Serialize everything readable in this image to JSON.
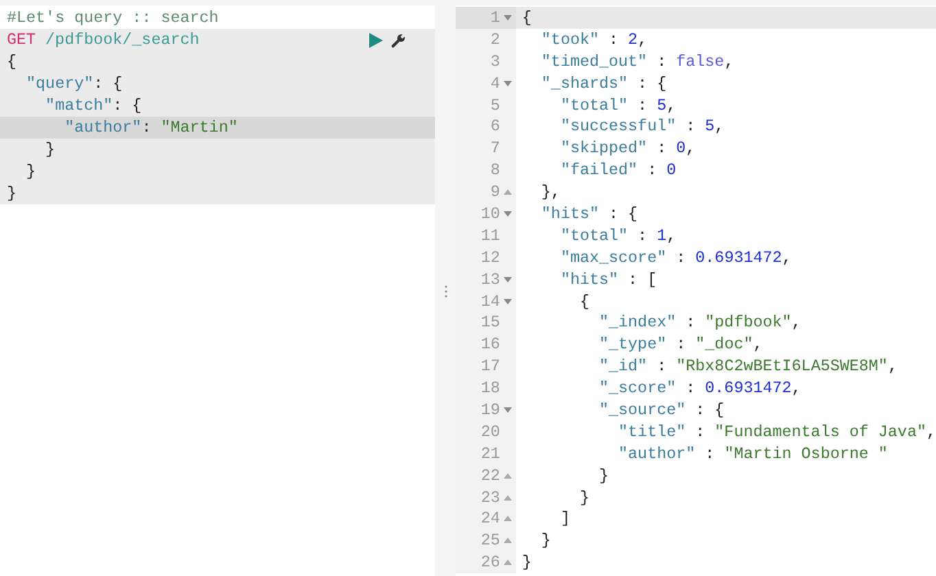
{
  "request_editor": {
    "comment": "#Let's query :: search",
    "method": "GET",
    "url": "/pdfbook/_search",
    "lines": [
      {
        "active": false,
        "tokens": [
          {
            "text": "{",
            "kind": "punct"
          }
        ]
      },
      {
        "active": false,
        "tokens": [
          {
            "text": "  \"query\"",
            "kind": "key"
          },
          {
            "text": ": {",
            "kind": "punct"
          }
        ]
      },
      {
        "active": false,
        "tokens": [
          {
            "text": "    \"match\"",
            "kind": "key"
          },
          {
            "text": ": {",
            "kind": "punct"
          }
        ]
      },
      {
        "active": true,
        "tokens": [
          {
            "text": "      \"author\"",
            "kind": "key"
          },
          {
            "text": ": ",
            "kind": "punct"
          },
          {
            "text": "\"Martin\"",
            "kind": "string"
          }
        ]
      },
      {
        "active": false,
        "tokens": [
          {
            "text": "    }",
            "kind": "punct"
          }
        ]
      },
      {
        "active": false,
        "tokens": [
          {
            "text": "  }",
            "kind": "punct"
          }
        ]
      },
      {
        "active": false,
        "tokens": [
          {
            "text": "}",
            "kind": "punct"
          }
        ]
      }
    ]
  },
  "response_viewer": {
    "lines": [
      {
        "number": "1",
        "kind": "open",
        "active": true,
        "tokens": [
          {
            "text": "{",
            "kind": "punct"
          }
        ]
      },
      {
        "number": "2",
        "kind": "plain",
        "active": false,
        "tokens": [
          {
            "text": "  \"took\"",
            "kind": "key"
          },
          {
            "text": " : ",
            "kind": "punct"
          },
          {
            "text": "2",
            "kind": "number"
          },
          {
            "text": ",",
            "kind": "punct"
          }
        ]
      },
      {
        "number": "3",
        "kind": "plain",
        "active": false,
        "tokens": [
          {
            "text": "  \"timed_out\"",
            "kind": "key"
          },
          {
            "text": " : ",
            "kind": "punct"
          },
          {
            "text": "false",
            "kind": "boolean"
          },
          {
            "text": ",",
            "kind": "punct"
          }
        ]
      },
      {
        "number": "4",
        "kind": "open",
        "active": false,
        "tokens": [
          {
            "text": "  \"_shards\"",
            "kind": "key"
          },
          {
            "text": " : {",
            "kind": "punct"
          }
        ]
      },
      {
        "number": "5",
        "kind": "plain",
        "active": false,
        "tokens": [
          {
            "text": "    \"total\"",
            "kind": "key"
          },
          {
            "text": " : ",
            "kind": "punct"
          },
          {
            "text": "5",
            "kind": "number"
          },
          {
            "text": ",",
            "kind": "punct"
          }
        ]
      },
      {
        "number": "6",
        "kind": "plain",
        "active": false,
        "tokens": [
          {
            "text": "    \"successful\"",
            "kind": "key"
          },
          {
            "text": " : ",
            "kind": "punct"
          },
          {
            "text": "5",
            "kind": "number"
          },
          {
            "text": ",",
            "kind": "punct"
          }
        ]
      },
      {
        "number": "7",
        "kind": "plain",
        "active": false,
        "tokens": [
          {
            "text": "    \"skipped\"",
            "kind": "key"
          },
          {
            "text": " : ",
            "kind": "punct"
          },
          {
            "text": "0",
            "kind": "number"
          },
          {
            "text": ",",
            "kind": "punct"
          }
        ]
      },
      {
        "number": "8",
        "kind": "plain",
        "active": false,
        "tokens": [
          {
            "text": "    \"failed\"",
            "kind": "key"
          },
          {
            "text": " : ",
            "kind": "punct"
          },
          {
            "text": "0",
            "kind": "number"
          }
        ]
      },
      {
        "number": "9",
        "kind": "close",
        "active": false,
        "tokens": [
          {
            "text": "  },",
            "kind": "punct"
          }
        ]
      },
      {
        "number": "10",
        "kind": "open",
        "active": false,
        "tokens": [
          {
            "text": "  \"hits\"",
            "kind": "key"
          },
          {
            "text": " : {",
            "kind": "punct"
          }
        ]
      },
      {
        "number": "11",
        "kind": "plain",
        "active": false,
        "tokens": [
          {
            "text": "    \"total\"",
            "kind": "key"
          },
          {
            "text": " : ",
            "kind": "punct"
          },
          {
            "text": "1",
            "kind": "number"
          },
          {
            "text": ",",
            "kind": "punct"
          }
        ]
      },
      {
        "number": "12",
        "kind": "plain",
        "active": false,
        "tokens": [
          {
            "text": "    \"max_score\"",
            "kind": "key"
          },
          {
            "text": " : ",
            "kind": "punct"
          },
          {
            "text": "0.6931472",
            "kind": "number"
          },
          {
            "text": ",",
            "kind": "punct"
          }
        ]
      },
      {
        "number": "13",
        "kind": "open",
        "active": false,
        "tokens": [
          {
            "text": "    \"hits\"",
            "kind": "key"
          },
          {
            "text": " : [",
            "kind": "punct"
          }
        ]
      },
      {
        "number": "14",
        "kind": "open",
        "active": false,
        "tokens": [
          {
            "text": "      {",
            "kind": "punct"
          }
        ]
      },
      {
        "number": "15",
        "kind": "plain",
        "active": false,
        "tokens": [
          {
            "text": "        \"_index\"",
            "kind": "key"
          },
          {
            "text": " : ",
            "kind": "punct"
          },
          {
            "text": "\"pdfbook\"",
            "kind": "string"
          },
          {
            "text": ",",
            "kind": "punct"
          }
        ]
      },
      {
        "number": "16",
        "kind": "plain",
        "active": false,
        "tokens": [
          {
            "text": "        \"_type\"",
            "kind": "key"
          },
          {
            "text": " : ",
            "kind": "punct"
          },
          {
            "text": "\"_doc\"",
            "kind": "string"
          },
          {
            "text": ",",
            "kind": "punct"
          }
        ]
      },
      {
        "number": "17",
        "kind": "plain",
        "active": false,
        "tokens": [
          {
            "text": "        \"_id\"",
            "kind": "key"
          },
          {
            "text": " : ",
            "kind": "punct"
          },
          {
            "text": "\"Rbx8C2wBEtI6LA5SWE8M\"",
            "kind": "string"
          },
          {
            "text": ",",
            "kind": "punct"
          }
        ]
      },
      {
        "number": "18",
        "kind": "plain",
        "active": false,
        "tokens": [
          {
            "text": "        \"_score\"",
            "kind": "key"
          },
          {
            "text": " : ",
            "kind": "punct"
          },
          {
            "text": "0.6931472",
            "kind": "number"
          },
          {
            "text": ",",
            "kind": "punct"
          }
        ]
      },
      {
        "number": "19",
        "kind": "open",
        "active": false,
        "tokens": [
          {
            "text": "        \"_source\"",
            "kind": "key"
          },
          {
            "text": " : {",
            "kind": "punct"
          }
        ]
      },
      {
        "number": "20",
        "kind": "plain",
        "active": false,
        "tokens": [
          {
            "text": "          \"title\"",
            "kind": "key"
          },
          {
            "text": " : ",
            "kind": "punct"
          },
          {
            "text": "\"Fundamentals of Java\"",
            "kind": "string"
          },
          {
            "text": ",",
            "kind": "punct"
          }
        ]
      },
      {
        "number": "21",
        "kind": "plain",
        "active": false,
        "tokens": [
          {
            "text": "          \"author\"",
            "kind": "key"
          },
          {
            "text": " : ",
            "kind": "punct"
          },
          {
            "text": "\"Martin Osborne \"",
            "kind": "string"
          }
        ]
      },
      {
        "number": "22",
        "kind": "close",
        "active": false,
        "tokens": [
          {
            "text": "        }",
            "kind": "punct"
          }
        ]
      },
      {
        "number": "23",
        "kind": "close",
        "active": false,
        "tokens": [
          {
            "text": "      }",
            "kind": "punct"
          }
        ]
      },
      {
        "number": "24",
        "kind": "close",
        "active": false,
        "tokens": [
          {
            "text": "    ]",
            "kind": "punct"
          }
        ]
      },
      {
        "number": "25",
        "kind": "close",
        "active": false,
        "tokens": [
          {
            "text": "  }",
            "kind": "punct"
          }
        ]
      },
      {
        "number": "26",
        "kind": "close",
        "active": false,
        "tokens": [
          {
            "text": "}",
            "kind": "punct"
          }
        ]
      }
    ]
  }
}
